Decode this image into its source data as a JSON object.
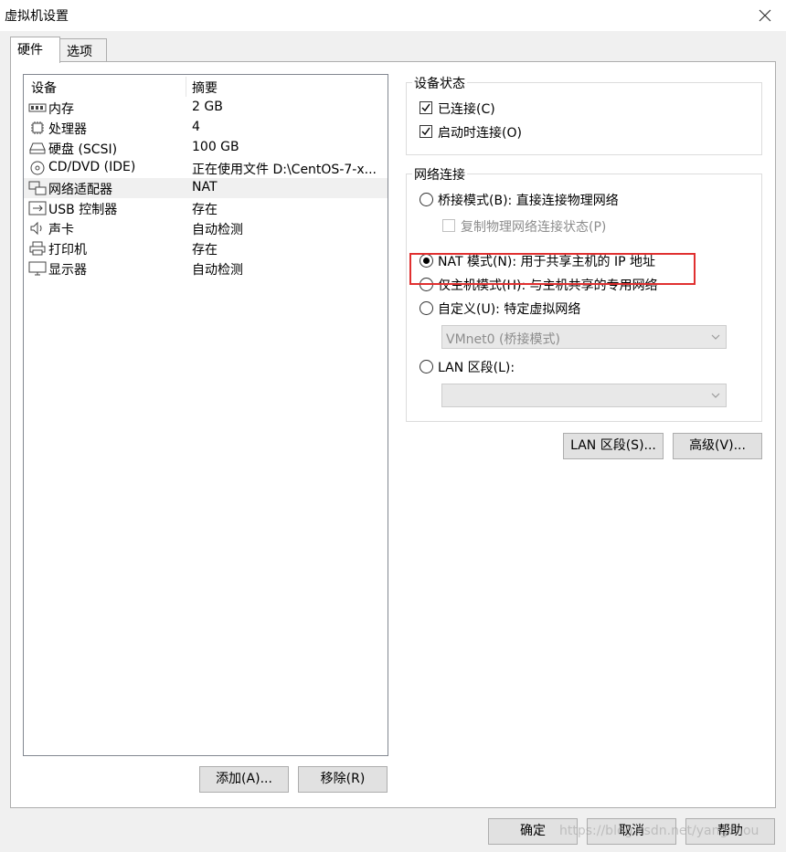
{
  "window": {
    "title": "虚拟机设置"
  },
  "tabs": [
    {
      "label": "硬件"
    },
    {
      "label": "选项"
    }
  ],
  "device_list": {
    "columns": {
      "device": "设备",
      "summary": "摘要"
    },
    "rows": [
      {
        "name": "内存",
        "value": "2 GB",
        "icon": "memory-icon"
      },
      {
        "name": "处理器",
        "value": "4",
        "icon": "processor-icon"
      },
      {
        "name": "硬盘 (SCSI)",
        "value": "100 GB",
        "icon": "hard-disk-icon"
      },
      {
        "name": "CD/DVD (IDE)",
        "value": "正在使用文件 D:\\CentOS-7-x...",
        "icon": "cd-dvd-icon"
      },
      {
        "name": "网络适配器",
        "value": "NAT",
        "icon": "network-adapter-icon"
      },
      {
        "name": "USB 控制器",
        "value": "存在",
        "icon": "usb-icon"
      },
      {
        "name": "声卡",
        "value": "自动检测",
        "icon": "speaker-icon"
      },
      {
        "name": "打印机",
        "value": "存在",
        "icon": "printer-icon"
      },
      {
        "name": "显示器",
        "value": "自动检测",
        "icon": "monitor-icon"
      }
    ]
  },
  "list_buttons": {
    "add": "添加(A)...",
    "remove": "移除(R)"
  },
  "device_status": {
    "title": "设备状态",
    "connected": "已连接(C)",
    "connect_at_power_on": "启动时连接(O)"
  },
  "network": {
    "title": "网络连接",
    "bridged": "桥接模式(B): 直接连接物理网络",
    "replicate": "复制物理网络连接状态(P)",
    "nat": "NAT 模式(N): 用于共享主机的 IP 地址",
    "host_only": "仅主机模式(H): 与主机共享的专用网络",
    "custom": "自定义(U): 特定虚拟网络",
    "vmnet_value": "VMnet0 (桥接模式)",
    "lan_segment": "LAN 区段(L):",
    "lan_segment_value": ""
  },
  "panel_buttons": {
    "lan_segments": "LAN 区段(S)...",
    "advanced": "高级(V)..."
  },
  "dialog_buttons": {
    "ok": "确定",
    "cancel": "取消",
    "help": "帮助"
  },
  "watermark": "https://blog.csdn.net/yangchou",
  "colors": {
    "highlight_box": "#e03030",
    "selected_row": "#f0f0f0"
  }
}
